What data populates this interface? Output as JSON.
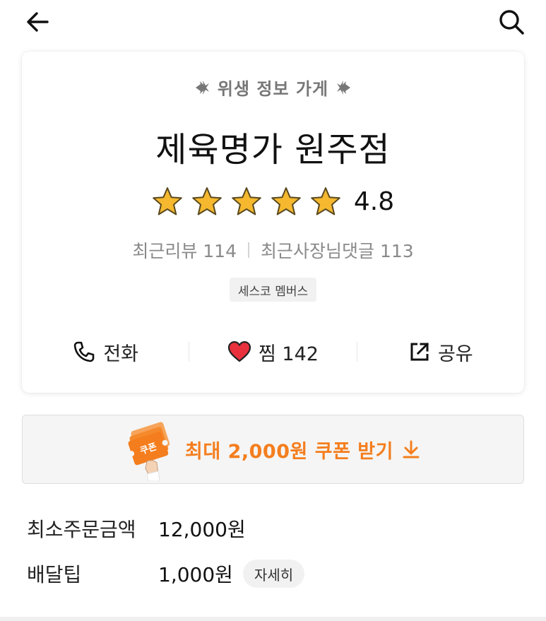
{
  "header": {
    "back_icon": "arrow-left-icon",
    "search_icon": "search-icon"
  },
  "store": {
    "hygiene_label": "위생 정보 가게",
    "name": "제육명가 원주점",
    "rating": "4.8",
    "stars_filled": 5,
    "stars_total": 5,
    "star_color": "#f5b82e",
    "recent_reviews": "최근리뷰 114",
    "owner_replies": "최근사장님댓글 113",
    "tag": "세스코 멤버스"
  },
  "actions": {
    "call_label": "전화",
    "call_icon": "phone-icon",
    "like_label": "찜 142",
    "like_icon": "heart-icon",
    "like_color": "#e8313d",
    "share_label": "공유",
    "share_icon": "share-icon"
  },
  "coupon": {
    "text": "최대 2,000원 쿠폰 받기",
    "badge_text": "쿠폰",
    "accent": "#f47e1e",
    "icon": "download-arrow-icon"
  },
  "info": {
    "min_order_label": "최소주문금액",
    "min_order_value": "12,000원",
    "delivery_tip_label": "배달팁",
    "delivery_tip_value": "1,000원",
    "detail_button": "자세히"
  }
}
